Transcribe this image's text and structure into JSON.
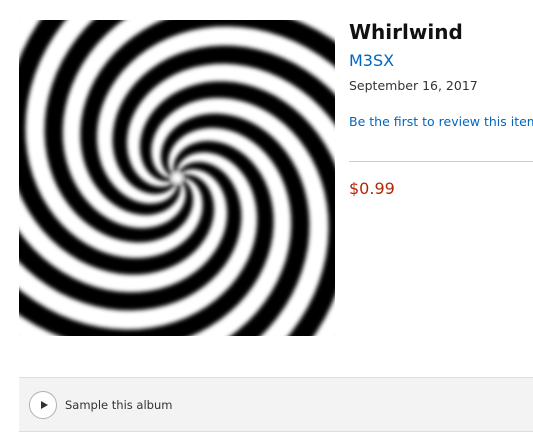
{
  "album": {
    "title": "Whirlwind",
    "artist": "M3SX",
    "release_date": "September 16, 2017",
    "review_link": "Be the first to review this item",
    "price": "$0.99"
  },
  "cover": {
    "icon": "black-white-spiral-artwork"
  },
  "sample": {
    "label": "Sample this album",
    "icon": "play-icon"
  },
  "colors": {
    "link": "#0066c0",
    "price": "#b12704",
    "bar_background": "#f3f3f3"
  }
}
